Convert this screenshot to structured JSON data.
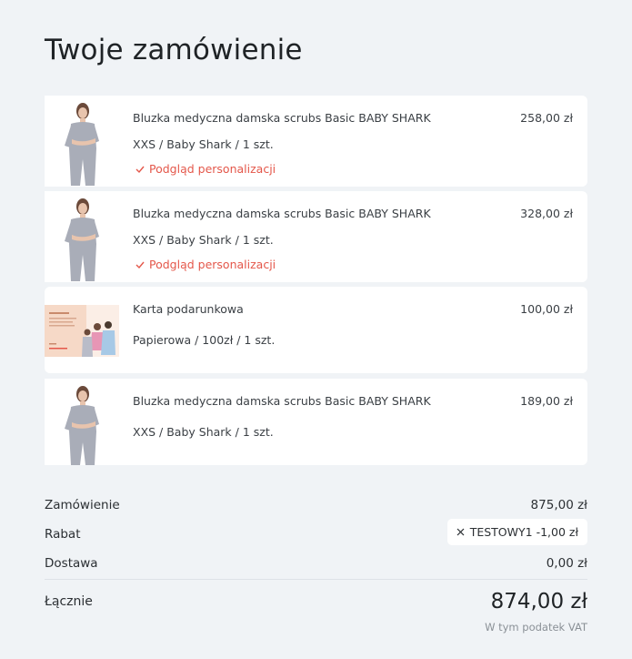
{
  "title": "Twoje zamówienie",
  "items": [
    {
      "name": "Bluzka medyczna damska scrubs Basic BABY SHARK",
      "variant": "XXS / Baby Shark / 1 szt.",
      "price": "258,00 zł",
      "personalization": "Podgląd personalizacji",
      "image": "scrubs-top-model"
    },
    {
      "name": "Bluzka medyczna damska scrubs Basic BABY SHARK",
      "variant": "XXS / Baby Shark / 1 szt.",
      "price": "328,00 zł",
      "personalization": "Podgląd personalizacji",
      "image": "scrubs-top-model"
    },
    {
      "name": "Karta podarunkowa",
      "variant": "Papierowa / 100zł / 1 szt.",
      "price": "100,00 zł",
      "image": "gift-card"
    },
    {
      "name": "Bluzka medyczna damska scrubs Basic BABY SHARK",
      "variant": "XXS / Baby Shark / 1 szt.",
      "price": "189,00 zł",
      "image": "scrubs-top-model"
    }
  ],
  "summary": {
    "order_label": "Zamówienie",
    "order_value": "875,00 zł",
    "discount_label": "Rabat",
    "discount_code": "TESTOWY1 -1,00 zł",
    "shipping_label": "Dostawa",
    "shipping_value": "0,00 zł",
    "total_label": "Łącznie",
    "total_value": "874,00 zł",
    "vat_note": "W tym podatek VAT"
  },
  "colors": {
    "background": "#f0f3f6",
    "card": "#ffffff",
    "accent": "#e4574a",
    "scrubs": "#a9adb8"
  }
}
